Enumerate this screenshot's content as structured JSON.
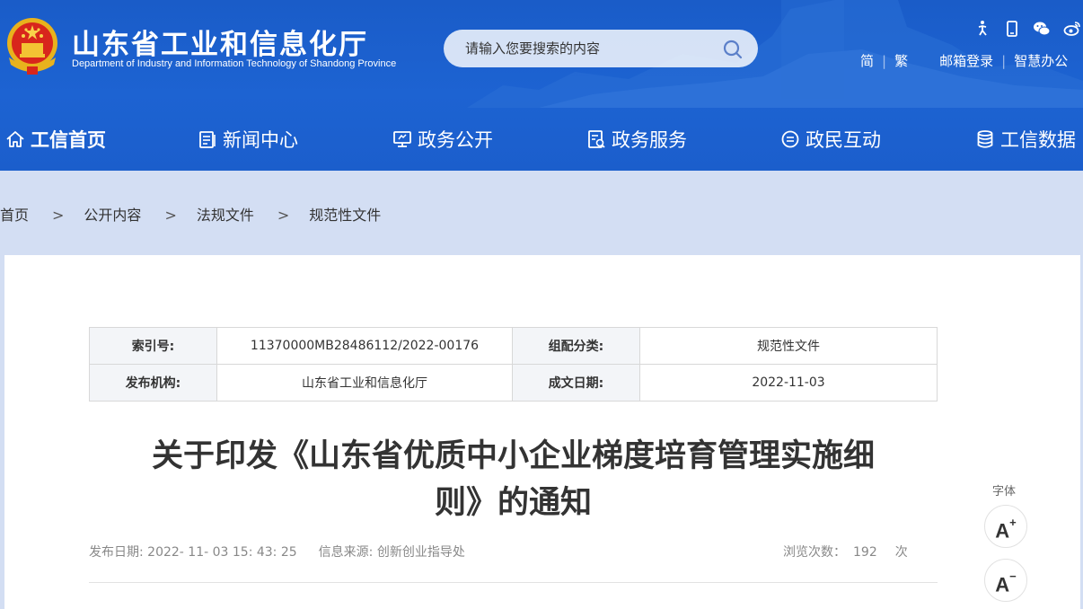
{
  "header": {
    "title": "山东省工业和信息化厅",
    "subtitle": "Department of Industry and Information Technology of Shandong Province",
    "search_placeholder": "请输入您要搜索的内容",
    "utility_icons": [
      "accessibility-icon",
      "mobile-icon",
      "wechat-icon",
      "weibo-icon"
    ],
    "links": {
      "simplified": "简",
      "traditional": "繁",
      "mail_login": "邮箱登录",
      "smart_office": "智慧办公"
    }
  },
  "nav": {
    "items": [
      {
        "label": "工信首页",
        "icon": "home-icon"
      },
      {
        "label": "新闻中心",
        "icon": "news-icon"
      },
      {
        "label": "政务公开",
        "icon": "monitor-icon"
      },
      {
        "label": "政务服务",
        "icon": "service-icon"
      },
      {
        "label": "政民互动",
        "icon": "chat-icon"
      },
      {
        "label": "工信数据",
        "icon": "database-icon"
      }
    ]
  },
  "breadcrumb": {
    "items": [
      "首页",
      "公开内容",
      "法规文件",
      "规范性文件"
    ],
    "separator": ">"
  },
  "meta": {
    "index_label": "索引号:",
    "index_value": "11370000MB28486112/2022-00176",
    "category_label": "组配分类:",
    "category_value": "规范性文件",
    "publisher_label": "发布机构:",
    "publisher_value": "山东省工业和信息化厅",
    "date_label": "成文日期:",
    "date_value": "2022-11-03"
  },
  "article": {
    "title_line1": "关于印发《山东省优质中小企业梯度培育管理实施细",
    "title_line2": "则》的通知",
    "publish_date": "发布日期: 2022- 11- 03 15: 43: 25",
    "source": "信息来源: 创新创业指导处",
    "views_label": "浏览次数：",
    "views_count": "192",
    "views_unit": "次"
  },
  "font_tools": {
    "label": "字体",
    "increase": "A",
    "increase_mark": "+",
    "decrease": "A",
    "decrease_mark": "−"
  },
  "colors": {
    "header_blue": "#1b5ecc",
    "breadcrumb_bg": "#d3def3"
  }
}
